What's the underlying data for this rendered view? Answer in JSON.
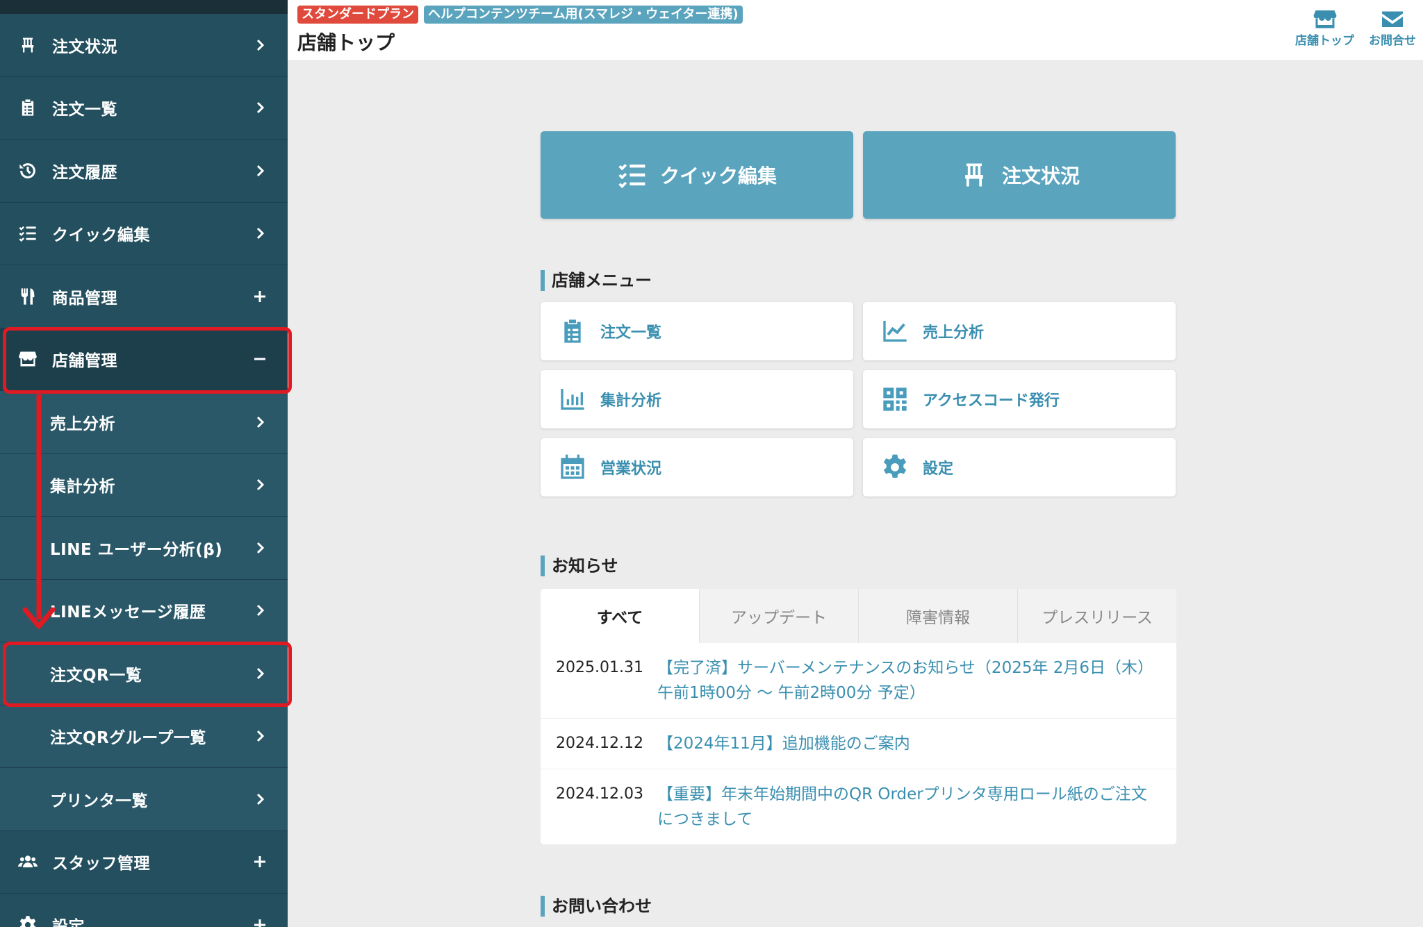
{
  "sidebar": {
    "items": [
      {
        "label": "注文状況",
        "icon": "chair-icon",
        "right": "chevron"
      },
      {
        "label": "注文一覧",
        "icon": "clipboard-icon",
        "right": "chevron"
      },
      {
        "label": "注文履歴",
        "icon": "history-icon",
        "right": "chevron"
      },
      {
        "label": "クイック編集",
        "icon": "list-check-icon",
        "right": "chevron"
      },
      {
        "label": "商品管理",
        "icon": "utensils-icon",
        "right": "plus"
      },
      {
        "label": "店舗管理",
        "icon": "store-icon",
        "right": "minus"
      },
      {
        "label": "売上分析",
        "right": "chevron"
      },
      {
        "label": "集計分析",
        "right": "chevron"
      },
      {
        "label": "LINE ユーザー分析(β)",
        "right": "chevron"
      },
      {
        "label": "LINEメッセージ履歴",
        "right": "chevron"
      },
      {
        "label": "注文QR一覧",
        "right": "chevron"
      },
      {
        "label": "注文QRグループ一覧",
        "right": "chevron"
      },
      {
        "label": "プリンタ一覧",
        "right": "chevron"
      },
      {
        "label": "スタッフ管理",
        "icon": "users-icon",
        "right": "plus"
      },
      {
        "label": "設定",
        "icon": "gear-icon",
        "right": "plus"
      }
    ]
  },
  "header": {
    "plan_badge": "スタンダードプラン",
    "store_badge": "ヘルプコンテンツチーム用(スマレジ・ウェイター連携)",
    "title": "店舗トップ",
    "store_top_label": "店舗トップ",
    "contact_label": "お問合せ"
  },
  "main": {
    "quick_edit_label": "クイック編集",
    "order_status_label": "注文状況",
    "store_menu_title": "店舗メニュー",
    "menu": {
      "order_list": "注文一覧",
      "sales_analysis": "売上分析",
      "aggregate_analysis": "集計分析",
      "access_code": "アクセスコード発行",
      "business_status": "営業状況",
      "settings": "設定"
    },
    "news_title": "お知らせ",
    "tabs": [
      "すべて",
      "アップデート",
      "障害情報",
      "プレスリリース"
    ],
    "news": [
      {
        "date": "2025.01.31",
        "title": "【完了済】サーバーメンテナンスのお知らせ（2025年 2月6日（木）午前1時00分 〜 午前2時00分 予定）"
      },
      {
        "date": "2024.12.12",
        "title": "【2024年11月】追加機能のご案内"
      },
      {
        "date": "2024.12.03",
        "title": "【重要】年末年始期間中のQR Orderプリンタ専用ロール紙のご注文につきまして"
      }
    ],
    "contact_title": "お問い合わせ"
  },
  "colors": {
    "sidebar_bg": "#234f5e",
    "accent": "#5ba4be",
    "link": "#3a8fb0",
    "highlight": "#e01a22"
  }
}
